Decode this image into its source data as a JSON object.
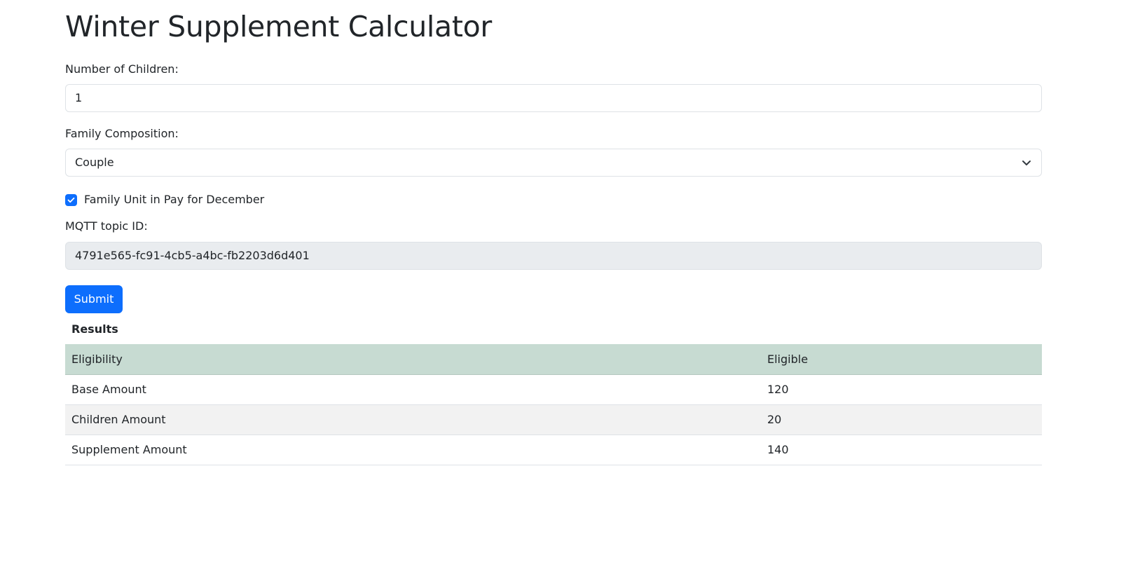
{
  "page": {
    "title": "Winter Supplement Calculator"
  },
  "form": {
    "children": {
      "label": "Number of Children:",
      "value": "1"
    },
    "composition": {
      "label": "Family Composition:",
      "value": "Couple"
    },
    "pay_for_december": {
      "label": "Family Unit in Pay for December",
      "checked": true
    },
    "mqtt": {
      "label": "MQTT topic ID:",
      "value": "4791e565-fc91-4cb5-a4bc-fb2203d6d401"
    },
    "submit_label": "Submit"
  },
  "results": {
    "heading": "Results",
    "rows": [
      {
        "label": "Eligibility",
        "value": "Eligible"
      },
      {
        "label": "Base Amount",
        "value": "120"
      },
      {
        "label": "Children Amount",
        "value": "20"
      },
      {
        "label": "Supplement Amount",
        "value": "140"
      }
    ]
  },
  "colors": {
    "accent": "#0d6efd",
    "table_header": "#c7dbd2",
    "stripe": "#f2f2f2",
    "disabled_field": "#e9ecef"
  },
  "icons": {
    "select_arrow": "chevron-down-icon",
    "checkbox_mark": "checkmark-icon"
  }
}
